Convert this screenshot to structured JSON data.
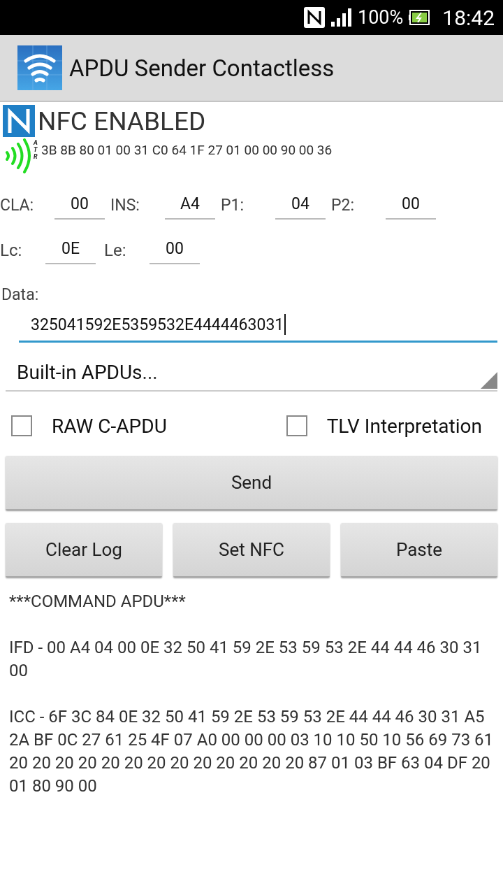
{
  "status_bar": {
    "battery": "100%",
    "time": "18:42"
  },
  "app_bar": {
    "title": "APDU Sender Contactless"
  },
  "nfc_status": "NFC ENABLED",
  "atr": {
    "label": "ATR",
    "value": "3B 8B 80 01 00 31 C0 64 1F 27 01 00 00 90 00 36"
  },
  "header_fields": [
    {
      "label": "CLA:",
      "value": "00"
    },
    {
      "label": "INS:",
      "value": "A4"
    },
    {
      "label": "P1:",
      "value": "04"
    },
    {
      "label": "P2:",
      "value": "00"
    }
  ],
  "length_fields": [
    {
      "label": "Lc:",
      "value": "0E"
    },
    {
      "label": "Le:",
      "value": "00"
    }
  ],
  "data": {
    "label": "Data:",
    "value": "325041592E5359532E4444463031"
  },
  "dropdown": {
    "value": "Built-in APDUs..."
  },
  "checkboxes": [
    {
      "label": "RAW C-APDU",
      "checked": false
    },
    {
      "label": "TLV Interpretation",
      "checked": false
    }
  ],
  "send_button": "Send",
  "buttons": [
    "Clear Log",
    "Set NFC",
    "Paste"
  ],
  "log": [
    "***COMMAND APDU***",
    "IFD - 00 A4 04 00 0E 32 50 41 59 2E 53 59 53 2E 44 44 46 30 31 00",
    "ICC - 6F 3C 84 0E 32 50 41 59 2E 53 59 53 2E 44 44 46 30 31 A5 2A BF 0C 27 61 25 4F 07 A0 00 00 00 03 10 10 50 10 56 69 73 61 20 20 20 20 20 20 20 20 20 20 20 20 20 87 01 03 BF 63 04 DF 20 01 80 90 00"
  ]
}
